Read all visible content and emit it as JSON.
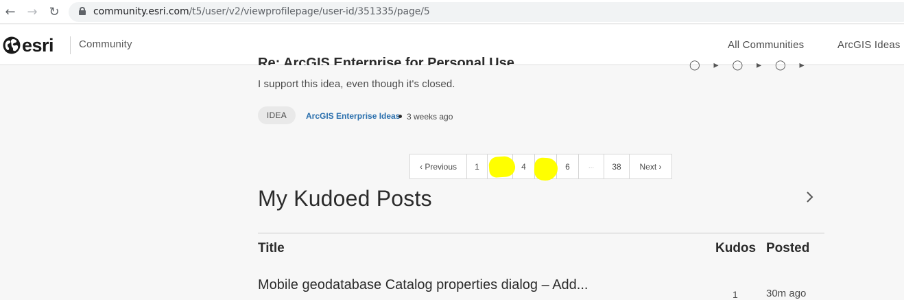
{
  "browser": {
    "url_domain": "community.esri.com",
    "url_path": "/t5/user/v2/viewprofilepage/user-id/351335/page/5",
    "icons": [
      "back-arrow-icon",
      "forward-arrow-icon",
      "reload-icon",
      "lock-icon"
    ]
  },
  "header": {
    "logo_text": "esri",
    "community_label": "Community",
    "nav_links": [
      "All Communities",
      "ArcGIS Ideas"
    ]
  },
  "reply_item": {
    "title_clipped": "Re: ArcGIS Enterprise for Personal Use",
    "body": "I support this idea, even though it's closed.",
    "tag": "IDEA",
    "board": "ArcGIS Enterprise Ideas",
    "time_ago": "3 weeks ago"
  },
  "pagination": {
    "prev_label": "Previous",
    "next_label": "Next",
    "pages": [
      "1",
      "",
      "4",
      "",
      "6",
      "...",
      "38"
    ],
    "current_page": "5",
    "highlight_color": "#ffff00"
  },
  "kudoed_posts": {
    "section_title": "My Kudoed Posts",
    "columns": {
      "title": "Title",
      "kudos": "Kudos",
      "posted": "Posted"
    },
    "rows": [
      {
        "title": "Mobile geodatabase Catalog properties dialog – Add...",
        "kudos": "1",
        "posted": "30m ago"
      }
    ]
  },
  "colors": {
    "link": "#2a6fad",
    "page_background": "#f7f7f7",
    "header_background": "#ffffff"
  }
}
